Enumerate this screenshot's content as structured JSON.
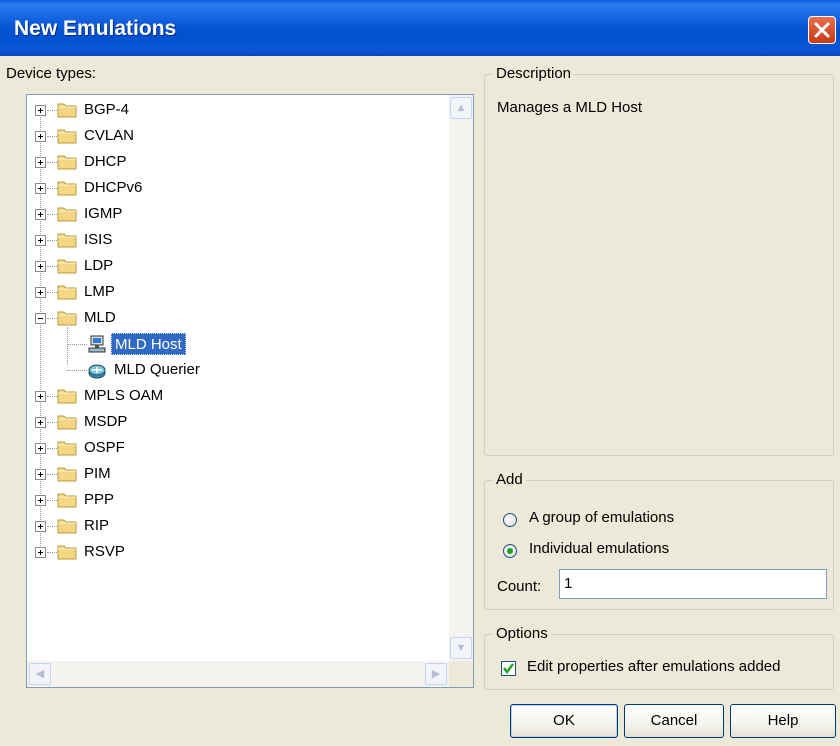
{
  "window": {
    "title": "New Emulations"
  },
  "device_types": {
    "label": "Device types:",
    "tree": [
      {
        "label": "BGP-4",
        "expanded": false
      },
      {
        "label": "CVLAN",
        "expanded": false
      },
      {
        "label": "DHCP",
        "expanded": false
      },
      {
        "label": "DHCPv6",
        "expanded": false
      },
      {
        "label": "IGMP",
        "expanded": false
      },
      {
        "label": "ISIS",
        "expanded": false
      },
      {
        "label": "LDP",
        "expanded": false
      },
      {
        "label": "LMP",
        "expanded": false
      },
      {
        "label": "MLD",
        "expanded": true,
        "children": [
          {
            "label": "MLD Host",
            "selected": true,
            "icon": "host-computer-icon"
          },
          {
            "label": "MLD Querier",
            "selected": false,
            "icon": "router-icon"
          }
        ]
      },
      {
        "label": "MPLS OAM",
        "expanded": false
      },
      {
        "label": "MSDP",
        "expanded": false
      },
      {
        "label": "OSPF",
        "expanded": false
      },
      {
        "label": "PIM",
        "expanded": false
      },
      {
        "label": "PPP",
        "expanded": false
      },
      {
        "label": "RIP",
        "expanded": false
      },
      {
        "label": "RSVP",
        "expanded": false
      }
    ]
  },
  "description": {
    "title": "Description",
    "text": "Manages a MLD Host"
  },
  "add": {
    "title": "Add",
    "options": [
      {
        "label": "A group of emulations",
        "selected": false
      },
      {
        "label": "Individual emulations",
        "selected": true
      }
    ],
    "count_label": "Count:",
    "count_value": "1"
  },
  "options": {
    "title": "Options",
    "edit_after_add_label": "Edit properties after emulations added",
    "edit_after_add_checked": true
  },
  "buttons": {
    "ok": "OK",
    "cancel": "Cancel",
    "help": "Help"
  },
  "colors": {
    "selection": "#316ac5",
    "titlebar": "#0054e3",
    "dialog_bg": "#ece9d8",
    "close_button": "#d7502b",
    "radio_dot": "#21a121"
  }
}
